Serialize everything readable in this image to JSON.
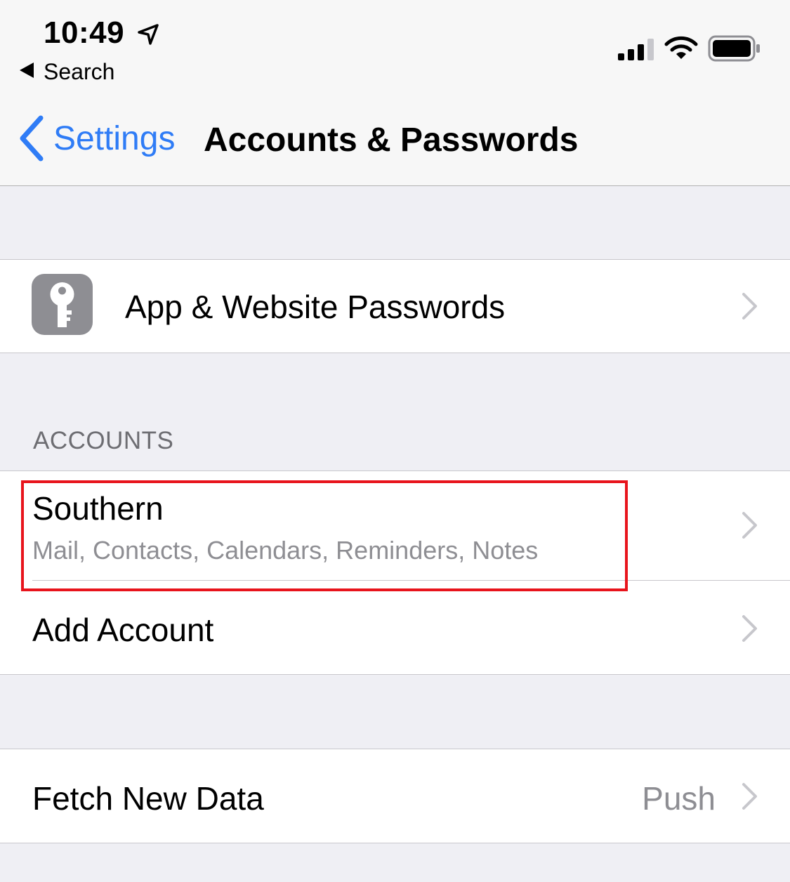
{
  "status_bar": {
    "time": "10:49",
    "back_label": "Search",
    "icons": [
      "location-arrow-icon",
      "cellular-signal-icon",
      "wifi-icon",
      "battery-icon"
    ]
  },
  "nav": {
    "back_label": "Settings",
    "title": "Accounts & Passwords"
  },
  "passwords_row": {
    "icon": "key-icon",
    "label": "App & Website Passwords"
  },
  "accounts_section": {
    "header": "ACCOUNTS",
    "items": [
      {
        "title": "Southern",
        "subtitle": "Mail, Contacts, Calendars, Reminders, Notes"
      },
      {
        "title": "Add Account"
      }
    ]
  },
  "fetch_row": {
    "label": "Fetch New Data",
    "value": "Push"
  },
  "colors": {
    "accent": "#2f7cf6",
    "highlight": "#e8141c",
    "background": "#efeff4",
    "secondary_text": "#8e8e93"
  }
}
